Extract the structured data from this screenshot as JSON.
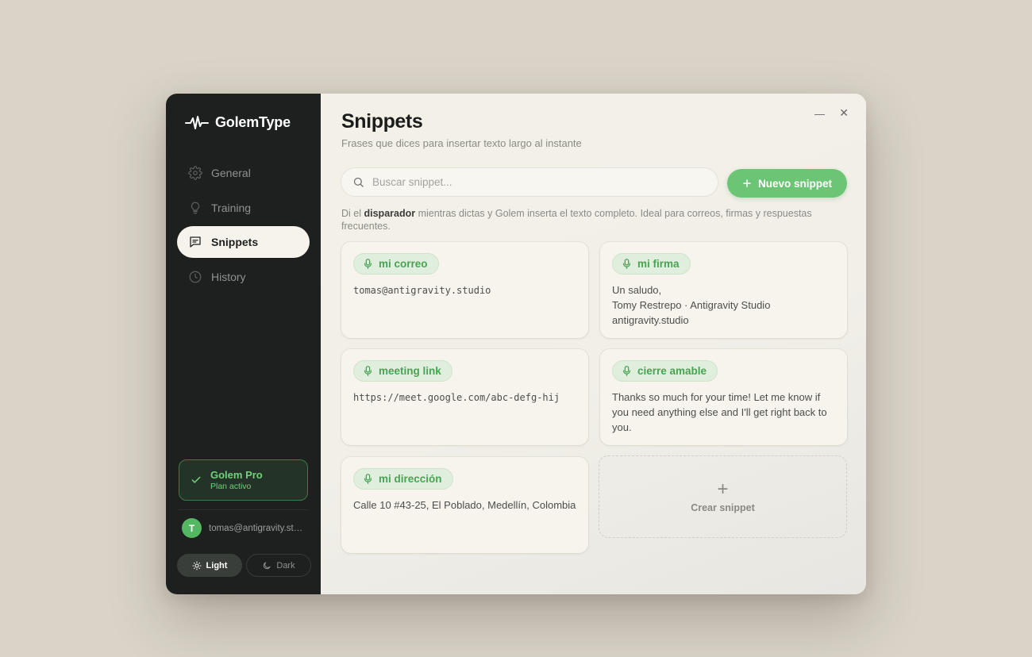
{
  "app": {
    "name": "GolemType"
  },
  "sidebar": {
    "items": [
      {
        "label": "General",
        "icon": "gear-icon",
        "active": false
      },
      {
        "label": "Training",
        "icon": "lightbulb-icon",
        "active": false
      },
      {
        "label": "Snippets",
        "icon": "message-square-icon",
        "active": true
      },
      {
        "label": "History",
        "icon": "clock-icon",
        "active": false
      }
    ],
    "plan": {
      "title": "Golem Pro",
      "subtitle": "Plan activo"
    },
    "user": {
      "initial": "T",
      "email": "tomas@antigravity.studio"
    },
    "theme": {
      "light_label": "Light",
      "dark_label": "Dark",
      "selected": "Light"
    }
  },
  "main": {
    "title": "Snippets",
    "subtitle": "Frases que dices para insertar texto largo al instante",
    "search": {
      "placeholder": "Buscar snippet..."
    },
    "new_button": "Nuevo snippet",
    "info": {
      "prefix": "Di el",
      "keyword": "disparador",
      "suffix": "mientras dictas y Golem inserta el texto completo. Ideal para correos, firmas y respuestas frecuentes."
    },
    "snippets": [
      {
        "trigger": "mi correo",
        "text": "tomas@antigravity.studio",
        "mono": true
      },
      {
        "trigger": "mi firma",
        "lines": [
          "Un saludo,",
          "Tomy Restrepo · Antigravity Studio",
          "antigravity.studio"
        ]
      },
      {
        "trigger": "meeting link",
        "text": "https://meet.google.com/abc-defg-hij",
        "mono": true
      },
      {
        "trigger": "cierre amable",
        "text": "Thanks so much for your time! Let me know if you need anything else and I'll get right back to you."
      },
      {
        "trigger": "mi dirección",
        "text": "Calle 10 #43-25, El Poblado, Medellín, Colombia"
      }
    ],
    "create_label": "Crear snippet"
  },
  "colors": {
    "accent": "#6cc574",
    "sidebar_bg": "#1d201e",
    "trigger_text": "#48a452",
    "page_bg": "#d9d3c8"
  }
}
